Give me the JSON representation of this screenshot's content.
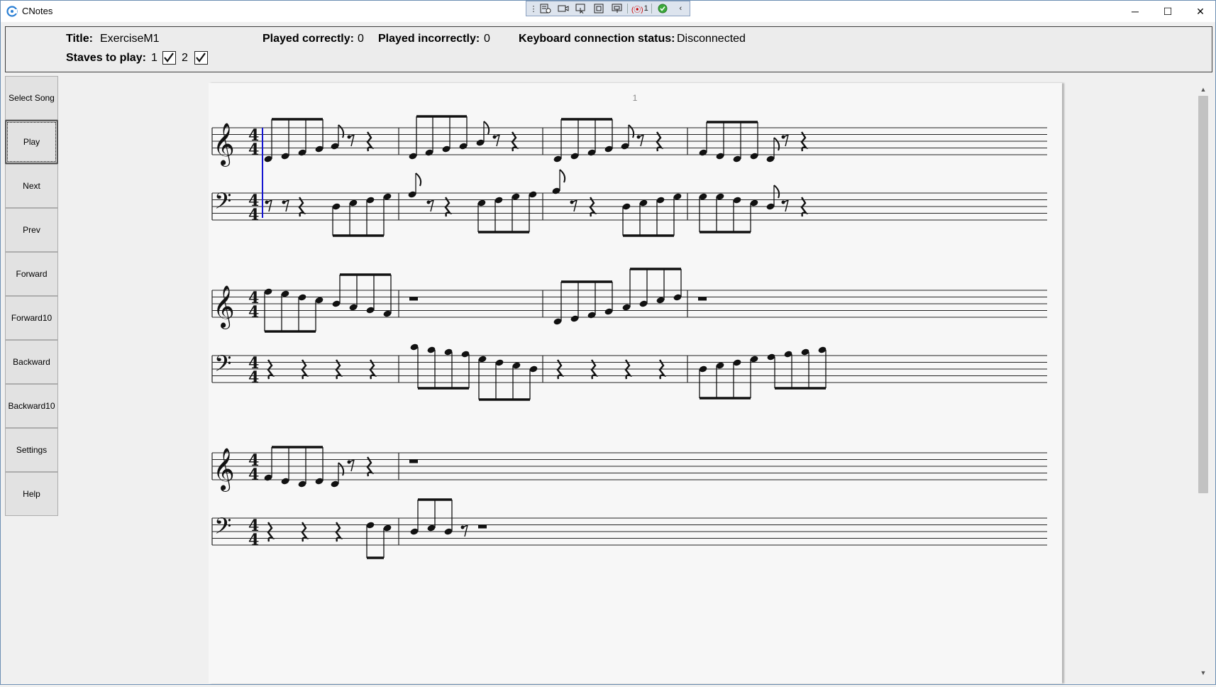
{
  "window": {
    "title": "CNotes",
    "controls": {
      "minimize": "─",
      "maximize": "☐",
      "close": "✕"
    }
  },
  "recorder_bar": {
    "count_label": "1"
  },
  "info": {
    "title_label": "Title:",
    "title_value": "ExerciseM1",
    "staves_label": "Staves to play:",
    "stave_1_label": "1",
    "stave_1_checked": true,
    "stave_2_label": "2",
    "stave_2_checked": true,
    "played_correctly_label": "Played correctly:",
    "played_correctly_value": "0",
    "played_incorrectly_label": "Played incorrectly:",
    "played_incorrectly_value": "0",
    "keyboard_label": "Keyboard connection status:",
    "keyboard_value": "Disconnected"
  },
  "sidebar": {
    "items": [
      {
        "label": "Select Song"
      },
      {
        "label": "Play",
        "active": true
      },
      {
        "label": "Next"
      },
      {
        "label": "Prev"
      },
      {
        "label": "Forward"
      },
      {
        "label": "Forward10"
      },
      {
        "label": "Backward"
      },
      {
        "label": "Backward10"
      },
      {
        "label": "Settings"
      },
      {
        "label": "Help"
      }
    ]
  },
  "score": {
    "page_number": "1",
    "time_signature": {
      "top": "4",
      "bottom": "4"
    },
    "clefs": {
      "treble": "𝄞",
      "bass": "𝄢"
    },
    "cursor_color": "#1515d0",
    "systems": [
      {
        "measures": 4
      },
      {
        "measures": 4
      },
      {
        "measures": 2
      }
    ]
  }
}
